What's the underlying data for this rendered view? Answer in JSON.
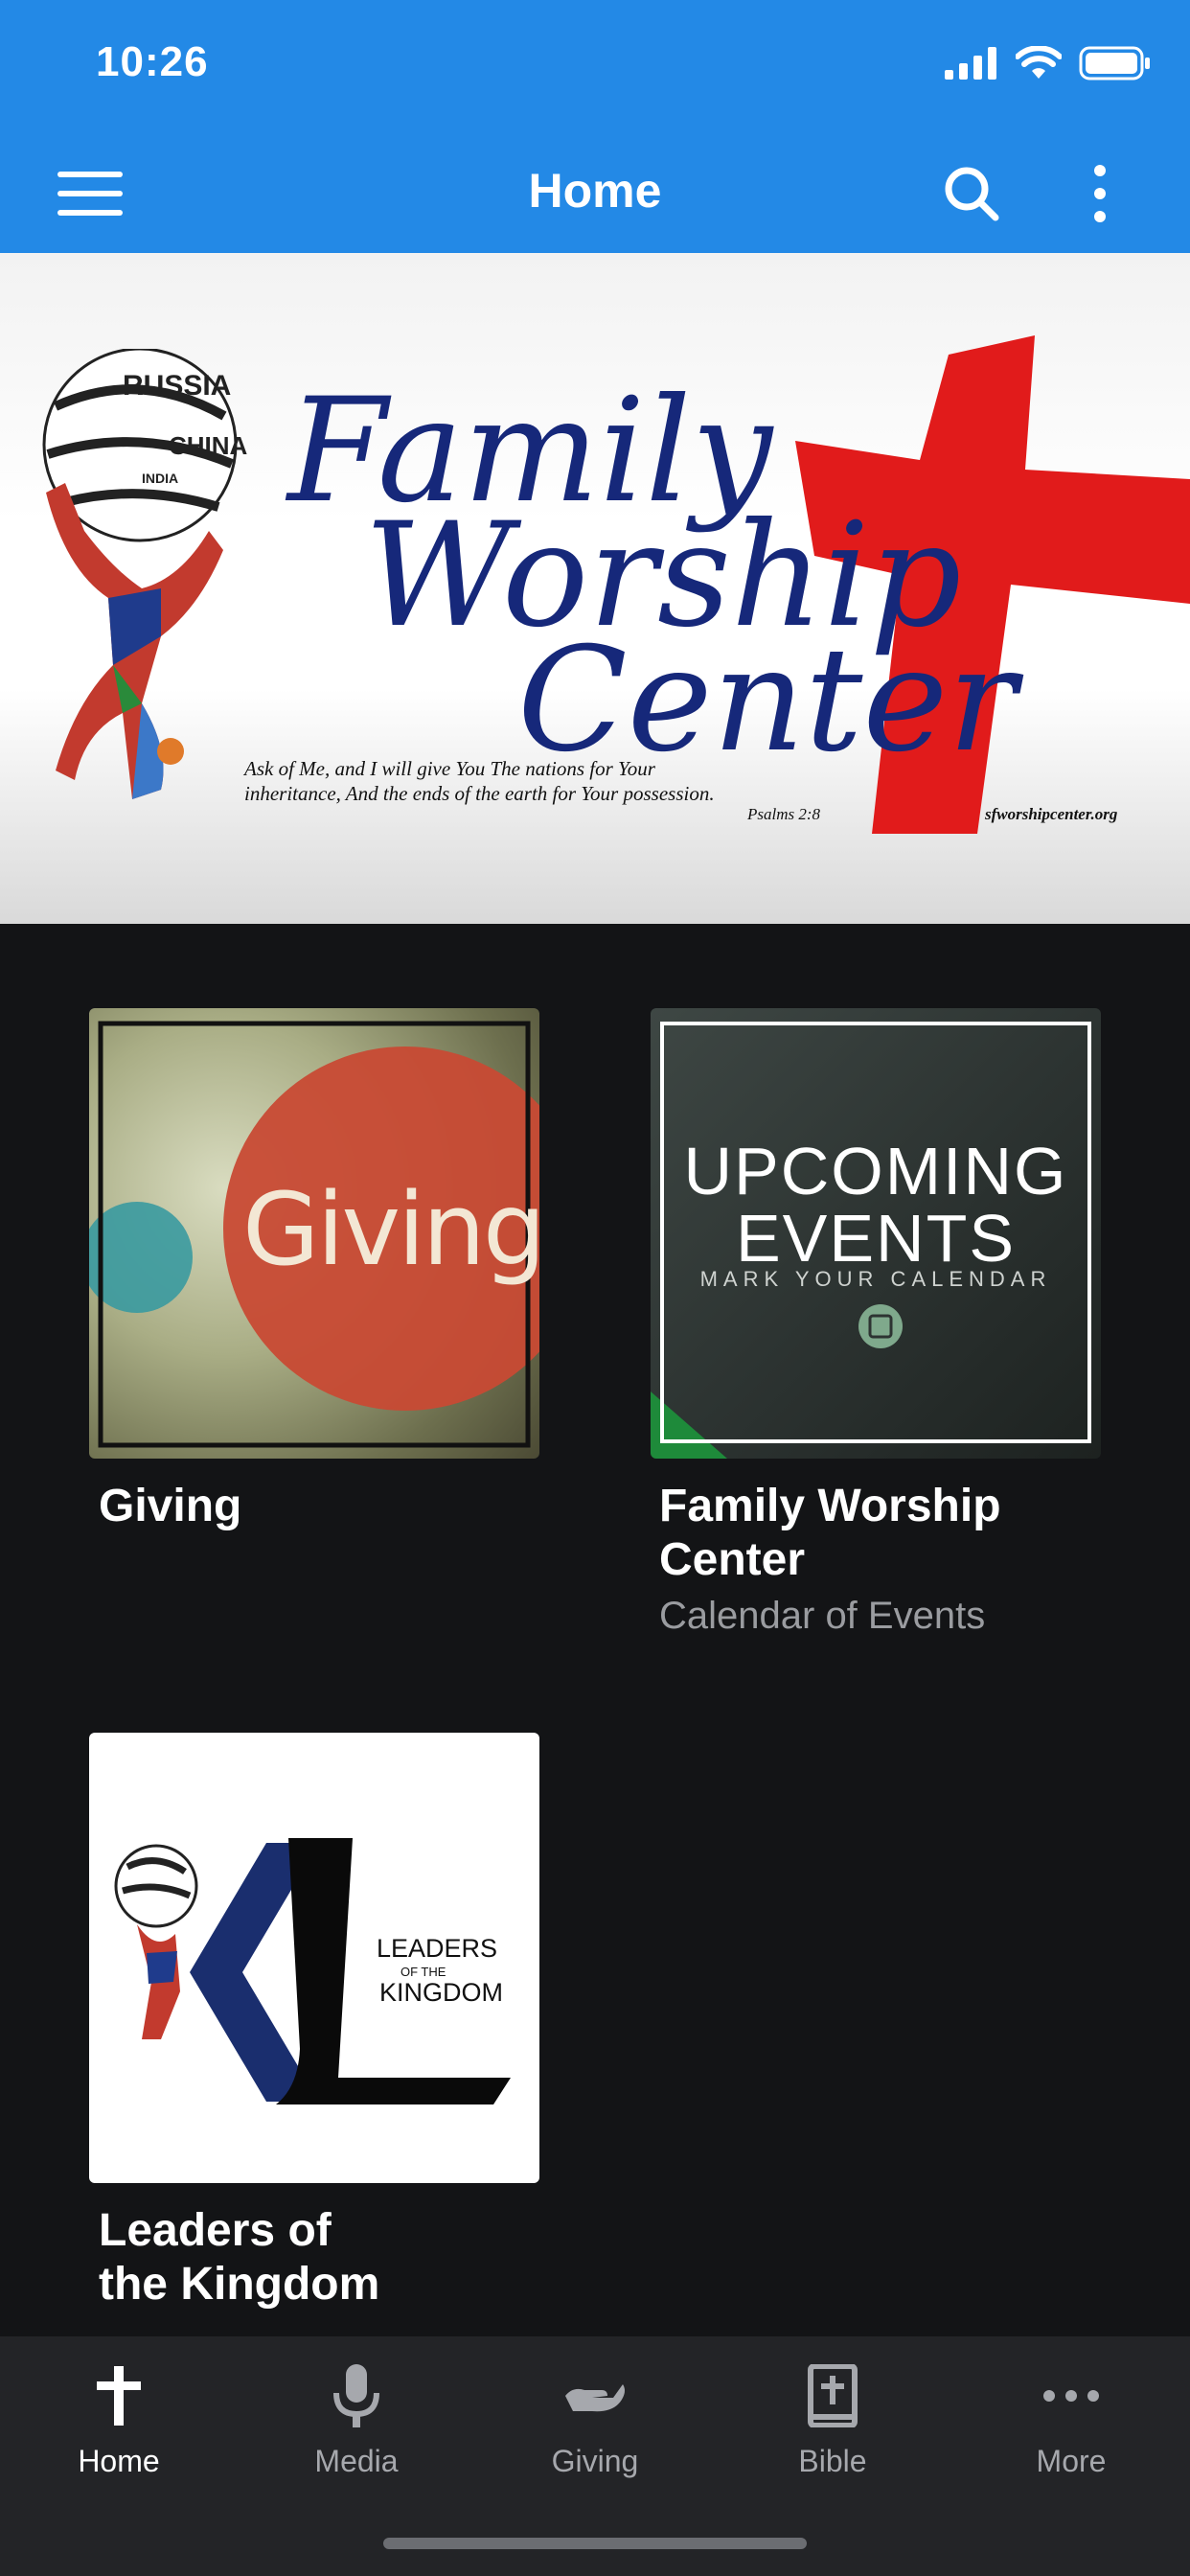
{
  "status": {
    "time": "10:26"
  },
  "header": {
    "title": "Home"
  },
  "banner": {
    "line1": "Family",
    "line2": "Worship",
    "line3": "Center",
    "verse_line1": "Ask of Me, and I will give You The nations for Your",
    "verse_line2": "inheritance, And the ends of the earth for Your possession.",
    "reference": "Psalms 2:8",
    "website": "sfworshipcenter.org",
    "globe_words": [
      "RUSSIA",
      "CHINA",
      "INDIA"
    ]
  },
  "tiles": [
    {
      "image_text": "Giving",
      "title": "Giving",
      "subtitle": ""
    },
    {
      "image_line1": "UPCOMING",
      "image_line2": "EVENTS",
      "image_line3": "MARK YOUR CALENDAR",
      "title_line1": "Family Worship",
      "title_line2": "Center",
      "subtitle": "Calendar of Events"
    },
    {
      "image_line1": "LEADERS",
      "image_line2": "OF THE",
      "image_line3": "KINGDOM",
      "title_line1": "Leaders of",
      "title_line2": "the Kingdom"
    }
  ],
  "tabs": [
    {
      "label": "Home",
      "icon": "cross-icon",
      "active": true
    },
    {
      "label": "Media",
      "icon": "microphone-icon",
      "active": false
    },
    {
      "label": "Giving",
      "icon": "giving-hand-icon",
      "active": false
    },
    {
      "label": "Bible",
      "icon": "bible-icon",
      "active": false
    },
    {
      "label": "More",
      "icon": "more-dots-icon",
      "active": false
    }
  ],
  "colors": {
    "accent": "#2389e6",
    "background": "#131416",
    "tabbar": "#232427"
  }
}
